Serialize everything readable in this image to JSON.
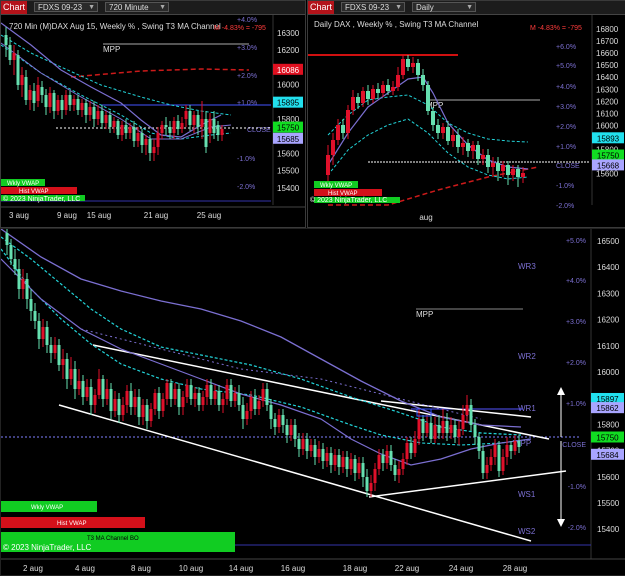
{
  "top_left": {
    "chart_button": "Chart",
    "instrument": "FDXS 09-23",
    "interval": "720 Minute",
    "title": "720 Min (M)DAX  Aug 15, Weekly % , Swing T3 MA Channel",
    "change_text": "M -4.83% = -795",
    "price_ticks": [
      "16300",
      "16200",
      "16100",
      "16000",
      "15900",
      "15800",
      "15700",
      "15600",
      "15500",
      "15400"
    ],
    "pct_ticks": [
      "+4.0%",
      "+3.0%",
      "+2.0%",
      "+1.0%",
      "-1.0%",
      "-2.0%"
    ],
    "close_label": "CLOSE",
    "mpp_label": "MPP",
    "date_ticks": [
      "3 aug",
      "9 aug",
      "15 aug",
      "21 aug",
      "25 aug"
    ],
    "price_tags": {
      "red": "16086",
      "cyan": "15895",
      "green": "15750",
      "blue": "15685"
    },
    "legend": {
      "vwap": "Wkly VWAP",
      "hvap": "Hist VWAP",
      "copyright": "© 2023 NinjaTrader, LLC"
    }
  },
  "top_right": {
    "chart_button": "Chart",
    "instrument": "FDXS 09-23",
    "interval": "Daily",
    "title": "Daily DAX , Weekly % , Swing T3 MA Channel",
    "change_text": "M -4.83% = -795",
    "price_ticks": [
      "16800",
      "16700",
      "16600",
      "16500",
      "16400",
      "16300",
      "16200",
      "16100",
      "16000",
      "15900",
      "15800",
      "15700",
      "15600"
    ],
    "pct_ticks": [
      "+6.0%",
      "+5.0%",
      "+4.0%",
      "+3.0%",
      "+2.0%",
      "+1.0%",
      "CLOSE",
      "-1.0%",
      "-2.0%"
    ],
    "mpp_label": "MPP",
    "date_ticks": [
      "aug"
    ],
    "price_tags": {
      "cyan": "15893",
      "green": "15750",
      "blue": "15668"
    },
    "legend": {
      "vwap": "Wkly VWAP",
      "hvap": "Hist VWAP",
      "copyright": "© 2023 NinjaTrader, LLC"
    }
  },
  "bottom": {
    "price_ticks": [
      "16500",
      "16400",
      "16300",
      "16200",
      "16100",
      "16000",
      "15900",
      "15800",
      "15700",
      "15600",
      "15500",
      "15400"
    ],
    "pct_ticks": [
      "+5.0%",
      "+4.0%",
      "+3.0%",
      "+2.0%",
      "+1.0%",
      "CLOSE",
      "-1.0%",
      "-2.0%"
    ],
    "level_labels": [
      "WR3",
      "WR2",
      "WR1",
      "WPP",
      "WS1",
      "WS2",
      "MPP"
    ],
    "date_ticks": [
      "2 aug",
      "4 aug",
      "8 aug",
      "10 aug",
      "14 aug",
      "16 aug",
      "18 aug",
      "22 aug",
      "24 aug",
      "28 aug"
    ],
    "price_tags": {
      "cyan": "15897",
      "blue1": "15862",
      "green": "15750",
      "blue2": "15684"
    },
    "legend": {
      "vwap": "Wkly VWAP",
      "hvap": "Hist VWAP",
      "channel": "T3 MA Channel BO",
      "copyright": "© 2023 NinjaTrader, LLC"
    }
  },
  "colors": {
    "up": "#66e0b0",
    "down": "#e0102a",
    "cyan": "#22d3d8",
    "purple": "#7b6fd1",
    "red_dash": "#cc1a1a",
    "white": "#ffffff",
    "green_tag": "#11dd22",
    "blue_tag": "#a9a5ff"
  }
}
